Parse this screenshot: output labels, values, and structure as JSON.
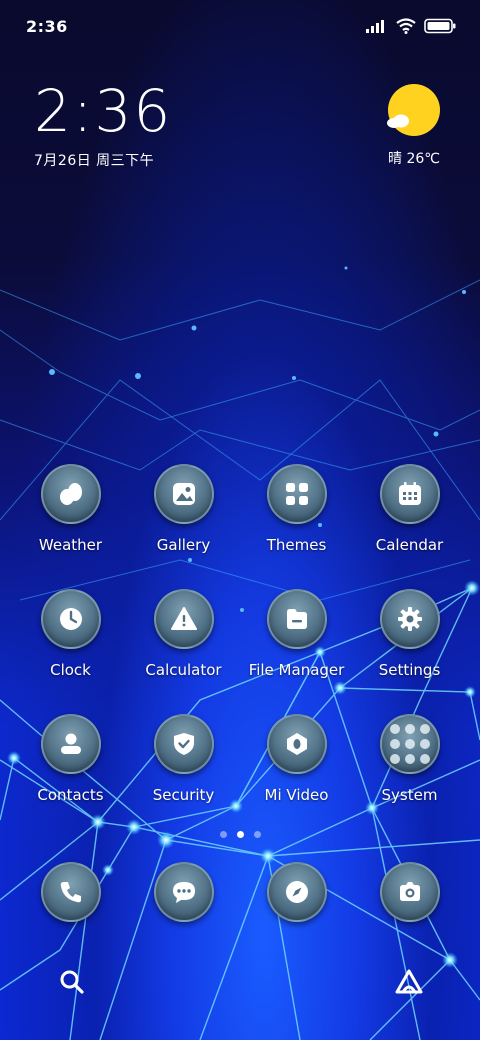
{
  "status_bar": {
    "time": "2:36"
  },
  "clock_widget": {
    "time": "2:36",
    "date": "7月26日 周三下午"
  },
  "weather_widget": {
    "text": "晴 26℃",
    "icon": "sunny-icon"
  },
  "apps": [
    {
      "label": "Weather",
      "icon": "weather-icon"
    },
    {
      "label": "Gallery",
      "icon": "gallery-icon"
    },
    {
      "label": "Themes",
      "icon": "themes-icon"
    },
    {
      "label": "Calendar",
      "icon": "calendar-icon"
    },
    {
      "label": "Clock",
      "icon": "clock-icon"
    },
    {
      "label": "Calculator",
      "icon": "calculator-icon"
    },
    {
      "label": "File Manager",
      "icon": "file-manager-icon"
    },
    {
      "label": "Settings",
      "icon": "gear-icon"
    },
    {
      "label": "Contacts",
      "icon": "contacts-icon"
    },
    {
      "label": "Security",
      "icon": "shield-icon"
    },
    {
      "label": "Mi Video",
      "icon": "video-icon"
    },
    {
      "label": "System",
      "icon": "folder-icon"
    }
  ],
  "dock": [
    {
      "name": "Phone",
      "icon": "phone-icon"
    },
    {
      "name": "Messaging",
      "icon": "chat-icon"
    },
    {
      "name": "Browser",
      "icon": "compass-icon"
    },
    {
      "name": "Camera",
      "icon": "camera-icon"
    }
  ],
  "page_indicator": {
    "pages": 3,
    "current": 2
  },
  "colors": {
    "sun": "#ffd21f",
    "background_top": "#0a0a2e",
    "background_bottom": "#0b2ad8",
    "icon_base": "#4f6f85"
  }
}
